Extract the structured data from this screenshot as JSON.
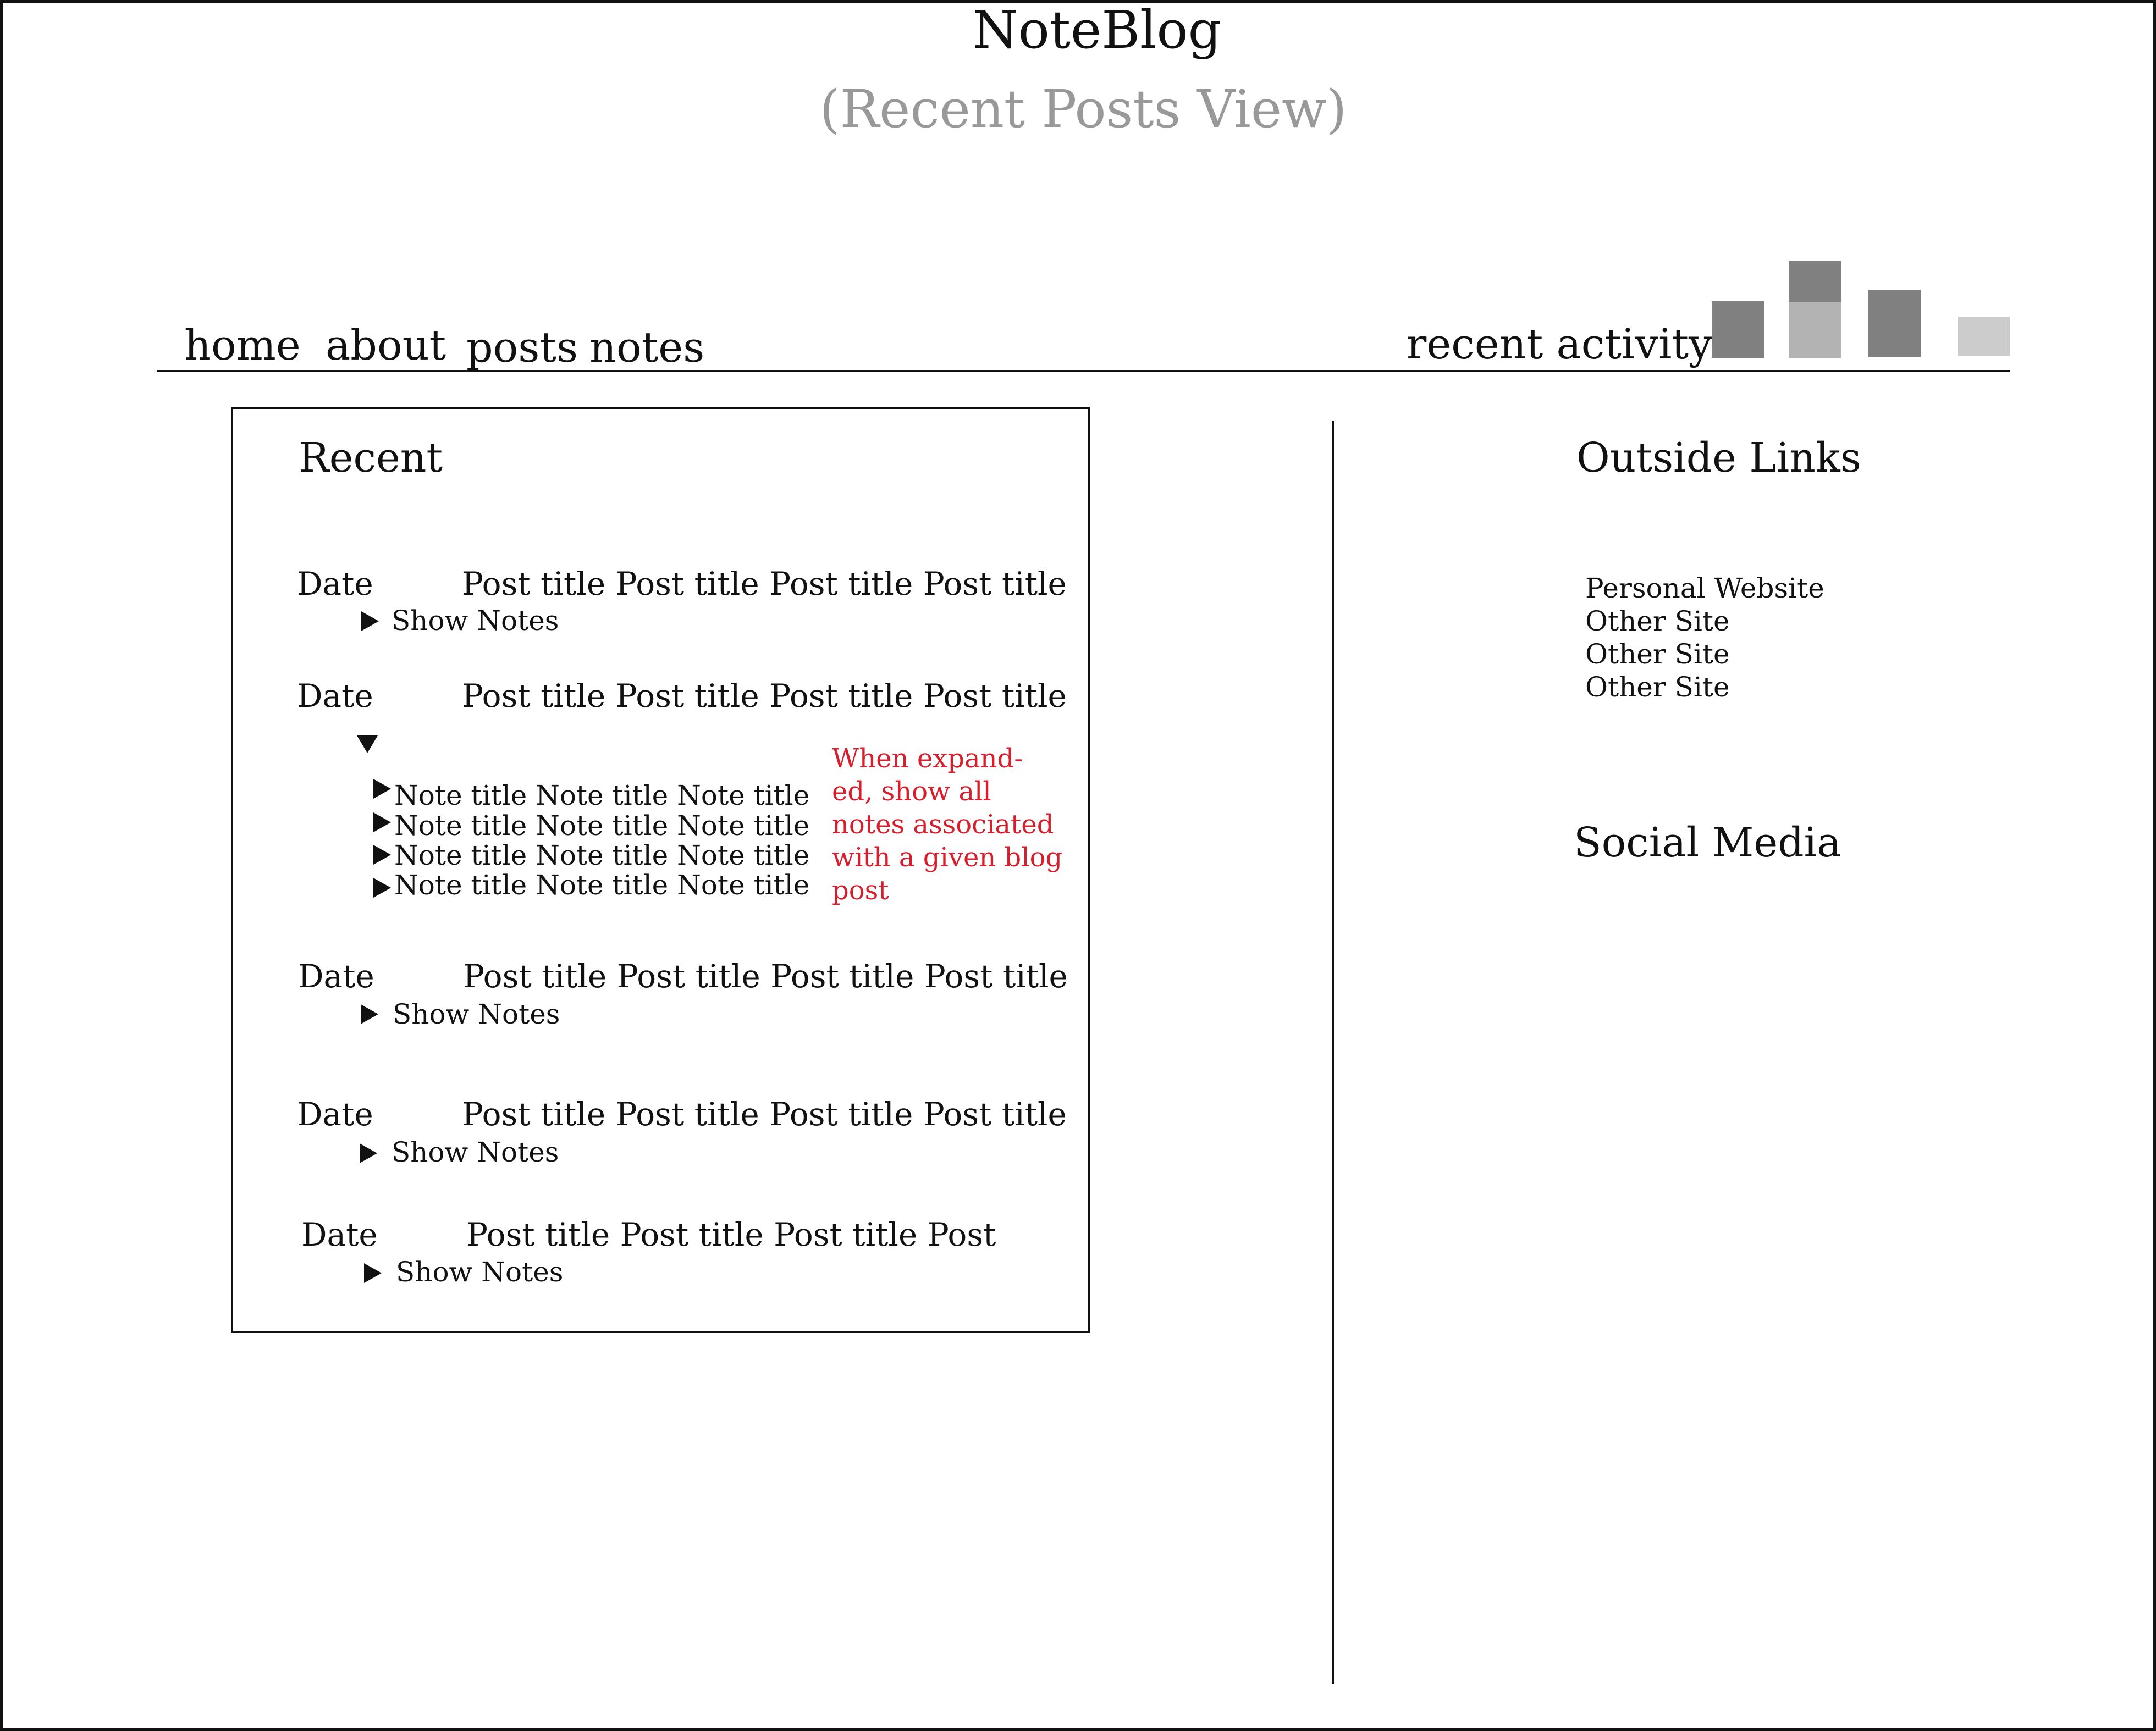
{
  "header": {
    "site_title": "NoteBlog",
    "view_label": "(Recent Posts View)"
  },
  "nav": {
    "home": "home",
    "about": "about",
    "posts": "posts",
    "notes": "notes",
    "recent_activity": "recent activity"
  },
  "activity_chart": {
    "colors": {
      "dark": "#808080",
      "light": "#b3b3b3",
      "lighter": "#cccccc"
    }
  },
  "recent": {
    "heading": "Recent",
    "show_notes_label": "Show Notes",
    "posts": [
      {
        "date": "Date",
        "title": "Post title Post title Post title Post title"
      },
      {
        "date": "Date",
        "title": "Post title Post title Post title Post title",
        "notes": [
          "Note title Note title Note title",
          "Note title Note title Note title",
          "Note title Note title Note title",
          "Note title Note title Note title"
        ]
      },
      {
        "date": "Date",
        "title": "Post title Post title Post title Post title"
      },
      {
        "date": "Date",
        "title": "Post title Post title Post title Post title"
      },
      {
        "date": "Date",
        "title": "Post title Post title Post title Post"
      }
    ],
    "annotation": "When expand-ed, show all notes associated with a given blog post",
    "annotation_color": "#d81e2c"
  },
  "sidebar": {
    "outside_links_heading": "Outside Links",
    "links": [
      "Personal Website",
      "Other Site",
      "Other Site",
      "Other Site"
    ],
    "social_heading": "Social Media"
  }
}
